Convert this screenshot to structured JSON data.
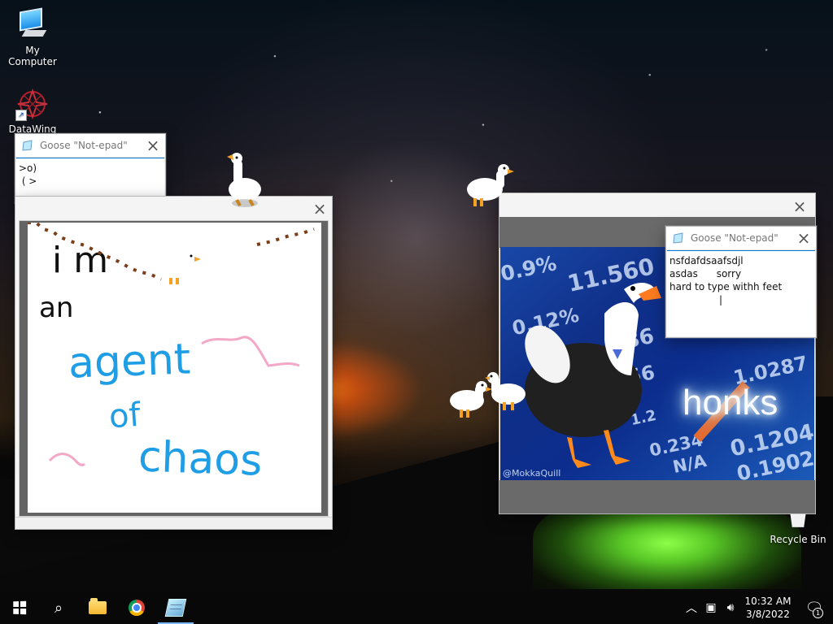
{
  "desktop": {
    "icons": [
      {
        "label": "My Computer",
        "icon": "computer-icon"
      },
      {
        "label": "DataWing",
        "icon": "datawing-icon"
      },
      {
        "label": "Recycle Bin",
        "icon": "recycle-bin-icon"
      }
    ]
  },
  "windows": {
    "notepad_small": {
      "title": "Goose \"Not-epad\"",
      "text": ">o)\n ( >"
    },
    "notepad_meme": {
      "title": "Goose \"Not-epad\"",
      "text": "nsfdafdsaafsdjl\nasdas      sorry\nhard to type withh feet\n                |"
    }
  },
  "paint": {
    "lines": [
      "i m",
      "an",
      "agent",
      "of",
      "chaos"
    ]
  },
  "meme": {
    "stocks": [
      "11.560",
      "0.9%",
      "0.12%",
      "286",
      "156",
      "0.234",
      "1.2",
      "N/A",
      "0.1204",
      "0.1902",
      "1.0287"
    ],
    "main_text": "honks",
    "credit": "@MokkaQuill"
  },
  "taskbar": {
    "apps": [
      "start",
      "search",
      "file-explorer",
      "chrome",
      "goose-notepad"
    ],
    "time": "10:32 AM",
    "date": "3/8/2022",
    "notifications": "1"
  },
  "colors": {
    "accent": "#0078d7",
    "paint_blue": "#1f9ee6",
    "paint_pink": "#f3a8c7",
    "paint_black": "#111111",
    "goose_orange": "#f4a126",
    "meme_blue": "#1948a8"
  }
}
